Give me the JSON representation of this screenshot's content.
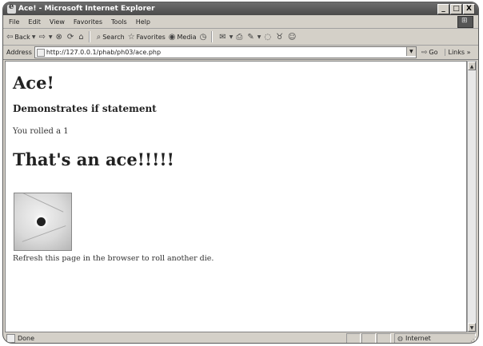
{
  "window": {
    "title": "Ace! - Microsoft Internet Explorer",
    "min_label": "_",
    "max_label": "□",
    "close_label": "X"
  },
  "menu": {
    "items": [
      "File",
      "Edit",
      "View",
      "Favorites",
      "Tools",
      "Help"
    ]
  },
  "toolbar": {
    "back": "Back",
    "search": "Search",
    "favorites": "Favorites",
    "media": "Media"
  },
  "address": {
    "label": "Address",
    "url": "http://127.0.0.1/phab/ph03/ace.php",
    "go": "Go",
    "links": "Links"
  },
  "page": {
    "heading": "Ace!",
    "subheading": "Demonstrates if statement",
    "roll_text": "You rolled a 1",
    "ace_message": "That's an ace!!!!!",
    "refresh_text": "Refresh this page in the browser to roll another die."
  },
  "status": {
    "text": "Done",
    "zone": "Internet"
  }
}
